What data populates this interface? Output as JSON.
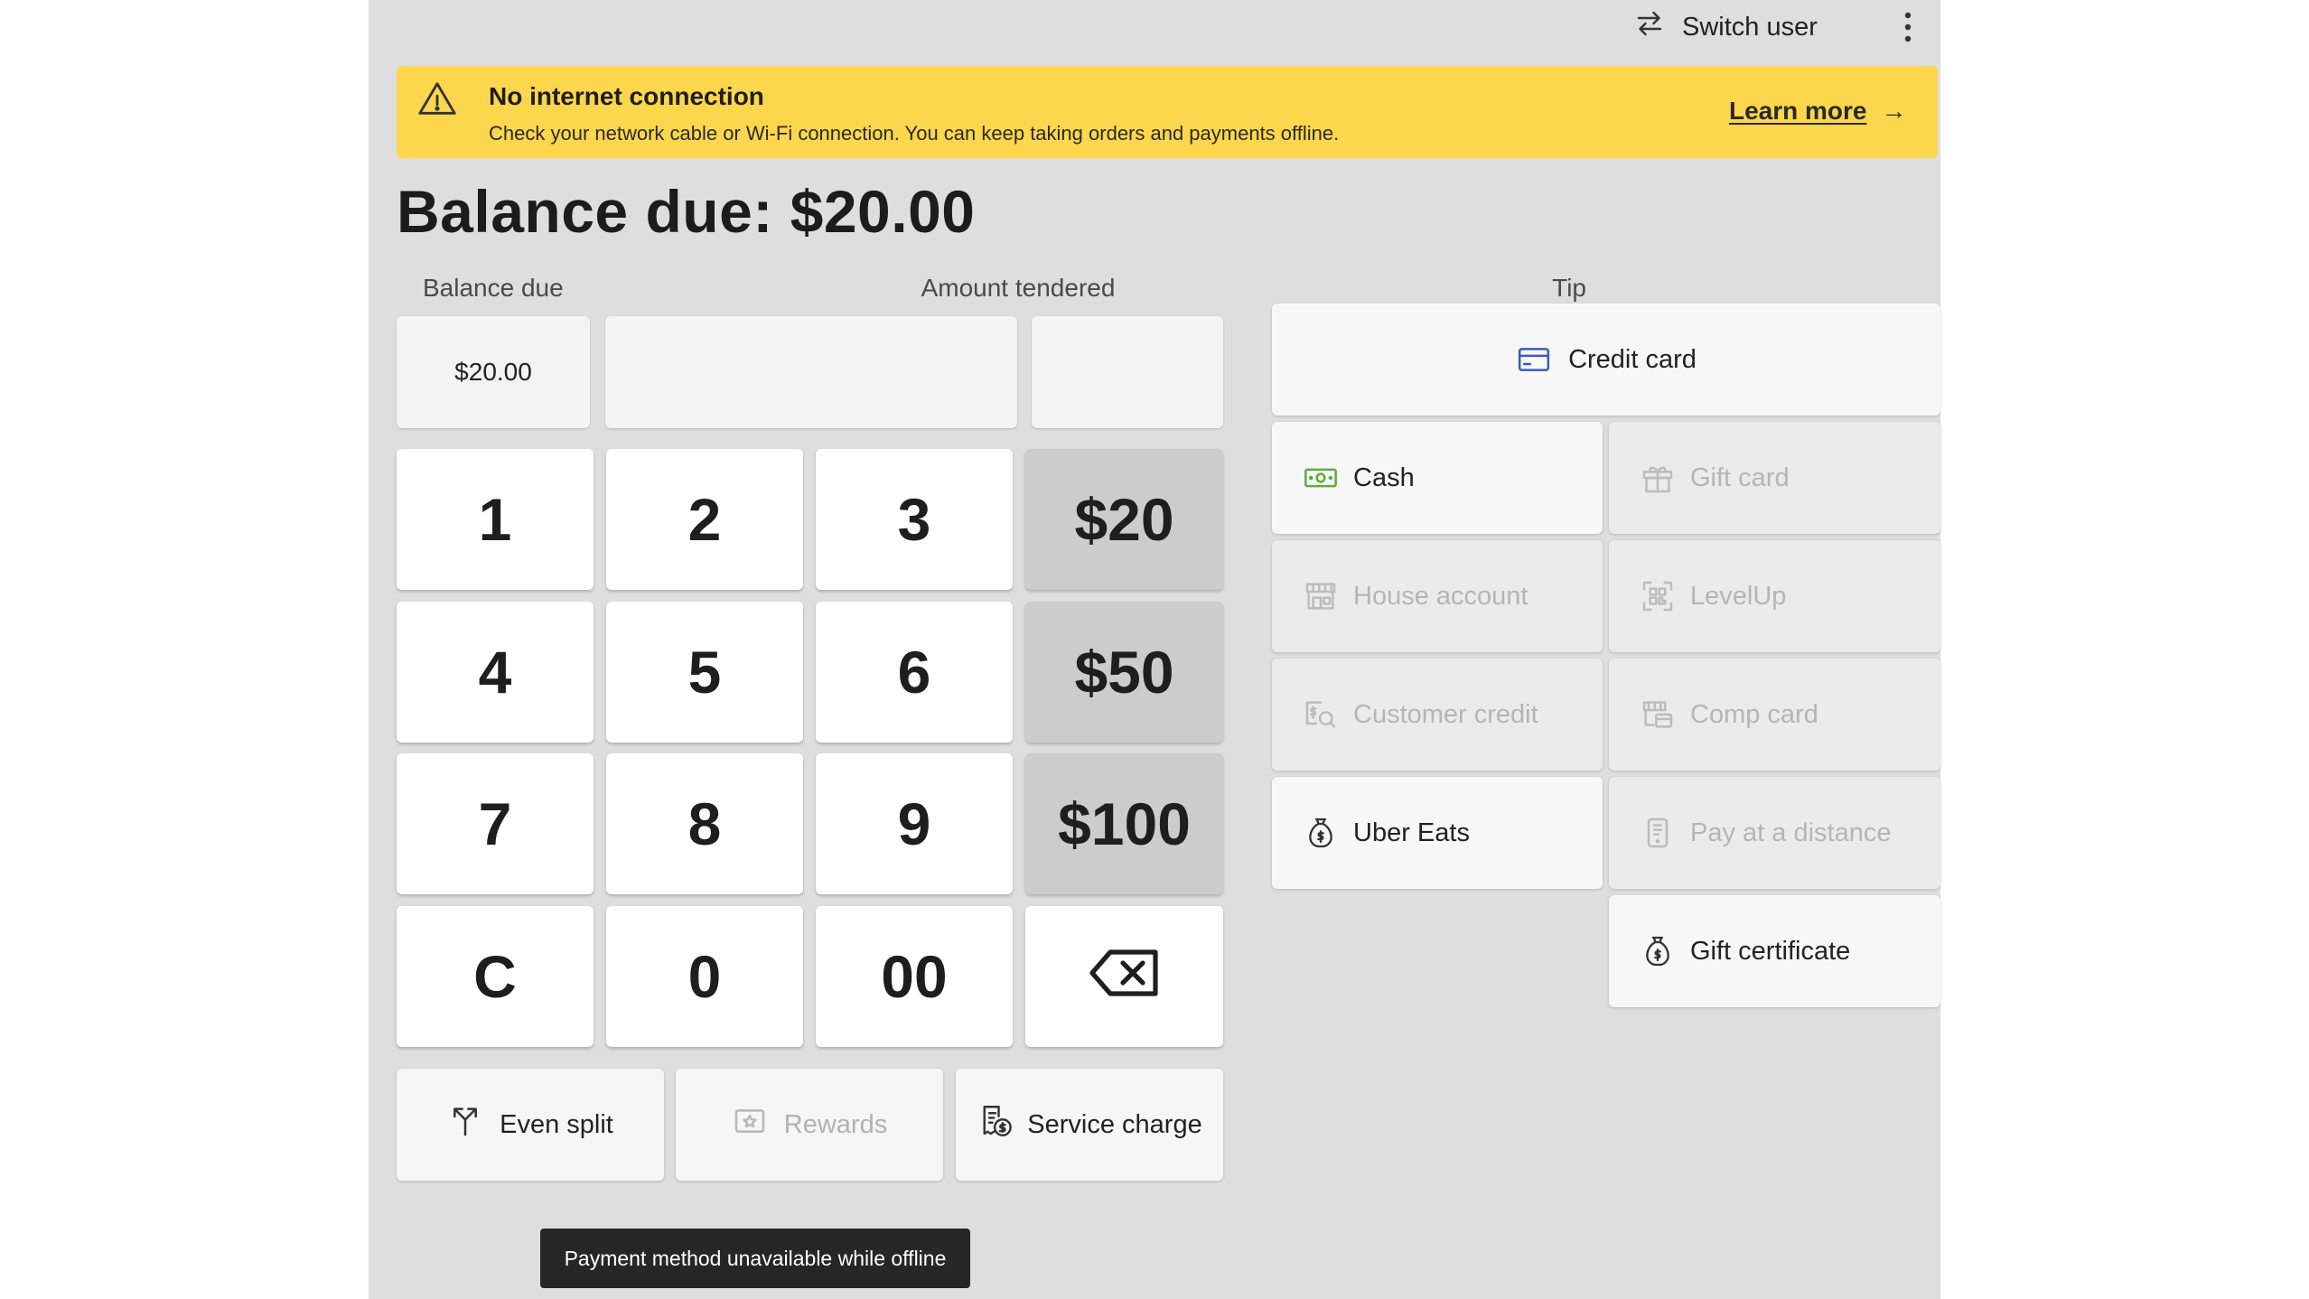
{
  "header": {
    "switch_user_label": "Switch user",
    "switch_icon": "swap-arrows-icon",
    "menu_icon": "more-vertical-icon"
  },
  "banner": {
    "title": "No internet connection",
    "message": "Check your network cable or Wi-Fi connection. You can keep taking orders and payments offline.",
    "link_label": "Learn more",
    "link_arrow": "→",
    "background_color": "#fcd64c"
  },
  "balance": {
    "title": "Balance due: $20.00",
    "labels": {
      "balance_due": "Balance due",
      "amount_tendered": "Amount tendered",
      "tip": "Tip"
    },
    "balance_due_value": "$20.00",
    "amount_tendered_value": "",
    "tip_value": ""
  },
  "keypad": {
    "k1": "1",
    "k2": "2",
    "k3": "3",
    "q20": "$20",
    "k4": "4",
    "k5": "5",
    "k6": "6",
    "q50": "$50",
    "k7": "7",
    "k8": "8",
    "k9": "9",
    "q100": "$100",
    "clear": "C",
    "k0": "0",
    "k00": "00",
    "backspace_icon": "backspace-icon"
  },
  "actions": {
    "even_split": "Even split",
    "rewards": "Rewards",
    "service_charge": "Service charge"
  },
  "payments": {
    "credit_card": "Credit card",
    "cash": "Cash",
    "gift_card": "Gift card",
    "house_account": "House account",
    "levelup": "LevelUp",
    "customer_credit": "Customer credit",
    "comp_card": "Comp card",
    "uber_eats": "Uber Eats",
    "pay_at_distance": "Pay at a distance",
    "gift_certificate": "Gift certificate"
  },
  "toast": "Payment method unavailable while offline",
  "colors": {
    "credit_card_icon": "#3b5bb5",
    "cash_icon": "#5cae3d",
    "quick_key_bg": "#cccccc"
  }
}
